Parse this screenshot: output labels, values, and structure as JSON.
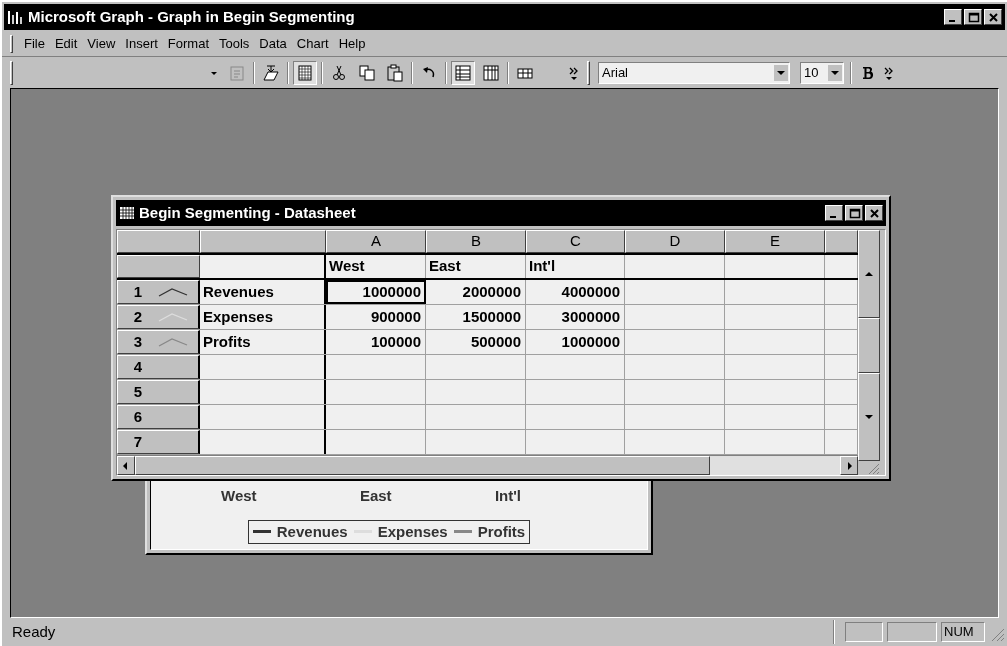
{
  "window": {
    "title": "Microsoft Graph - Graph in Begin Segmenting"
  },
  "menu": [
    {
      "label": "File"
    },
    {
      "label": "Edit"
    },
    {
      "label": "View"
    },
    {
      "label": "Insert"
    },
    {
      "label": "Format"
    },
    {
      "label": "Tools"
    },
    {
      "label": "Data"
    },
    {
      "label": "Chart"
    },
    {
      "label": "Help"
    }
  ],
  "toolbar": {
    "font_name": "Arial",
    "font_size": "10",
    "buttons": [
      {
        "kind": "properties",
        "pressed": false
      },
      {
        "kind": "import",
        "pressed": false
      },
      {
        "kind": "datasheet",
        "pressed": true
      },
      {
        "kind": "cut",
        "pressed": false
      },
      {
        "kind": "copy",
        "pressed": false
      },
      {
        "kind": "paste",
        "pressed": false
      },
      {
        "kind": "undo",
        "pressed": false
      },
      {
        "kind": "by-row",
        "pressed": true
      },
      {
        "kind": "by-column",
        "pressed": false
      },
      {
        "kind": "data-table",
        "pressed": false
      }
    ]
  },
  "datasheet": {
    "title": "Begin Segmenting - Datasheet",
    "columns": [
      "A",
      "B",
      "C",
      "D",
      "E"
    ],
    "series_labels": [
      "West",
      "East",
      "Int'l"
    ],
    "rows": [
      {
        "number": "1",
        "label": "Revenues",
        "color": "#333333",
        "cells": [
          {
            "text": "1000000",
            "selected": true
          },
          {
            "text": "2000000",
            "selected": false
          },
          {
            "text": "4000000",
            "selected": false
          }
        ]
      },
      {
        "number": "2",
        "label": "Expenses",
        "color": "#dddddd",
        "cells": [
          {
            "text": "900000",
            "selected": false
          },
          {
            "text": "1500000",
            "selected": false
          },
          {
            "text": "3000000",
            "selected": false
          }
        ]
      },
      {
        "number": "3",
        "label": "Profits",
        "color": "#888888",
        "cells": [
          {
            "text": "100000",
            "selected": false
          },
          {
            "text": "500000",
            "selected": false
          },
          {
            "text": "1000000",
            "selected": false
          }
        ]
      }
    ],
    "empty_rows": [
      "4",
      "5",
      "6",
      "7"
    ]
  },
  "chart": {
    "categories": [
      "West",
      "East",
      "Int'l"
    ],
    "legend": [
      {
        "label": "Revenues",
        "color": "#333333"
      },
      {
        "label": "Expenses",
        "color": "#dddddd"
      },
      {
        "label": "Profits",
        "color": "#888888"
      }
    ]
  },
  "status_bar": {
    "text": "Ready",
    "indicator": "NUM"
  }
}
